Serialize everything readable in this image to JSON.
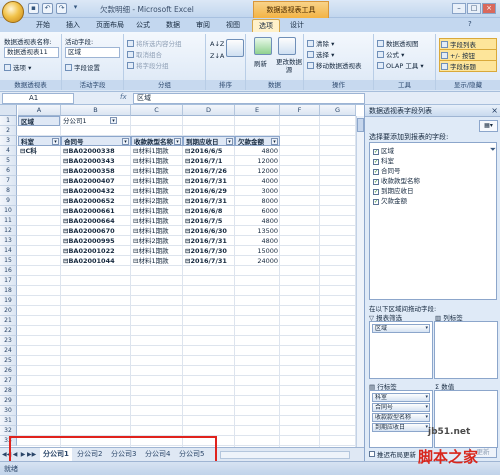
{
  "titlebar": {
    "window_title": "欠款明细 - Microsoft Excel",
    "contextual_group": "数据透视表工具"
  },
  "tabs": [
    "开始",
    "插入",
    "页面布局",
    "公式",
    "数据",
    "审阅",
    "视图",
    "选项",
    "设计"
  ],
  "active_tab": "选项",
  "ribbon": {
    "pivot_name_label": "数据透视表名称:",
    "pivot_name_value": "数据透视表11",
    "options_btn": "选项",
    "group1_label": "数据透视表",
    "active_field_label": "活动字段:",
    "active_field_value": "区域",
    "field_settings": "字段设置",
    "group2_label": "活动字段",
    "expand_btn": "将所选内容分组",
    "ungroup_btn": "取消组合",
    "groupfield_btn": "将字段分组",
    "group3_label": "分组",
    "sort_label": "排序",
    "group4_label": "排序",
    "refresh_label": "刷新",
    "change_source_label": "更改数据源",
    "group5_label": "数据",
    "clear_btn": "清除",
    "select_btn": "选择",
    "move_btn": "移动数据透视表",
    "group6_label": "操作",
    "pivotchart_btn": "数据透视图",
    "formula_btn": "公式",
    "olap_btn": "OLAP 工具",
    "group7_label": "工具",
    "field_list_btn": "字段列表",
    "plusminus_btn": "+/- 按钮",
    "field_headers_btn": "字段标题",
    "group8_label": "显示/隐藏"
  },
  "formula_bar": {
    "cell_ref": "A1",
    "fx": "fx",
    "content": "区域"
  },
  "columns": [
    "A",
    "B",
    "C",
    "D",
    "E",
    "F",
    "G"
  ],
  "rows": [
    "1",
    "2",
    "3",
    "4",
    "5",
    "6",
    "7",
    "8",
    "9",
    "10",
    "11",
    "12",
    "13",
    "14",
    "15",
    "16",
    "17",
    "18",
    "19",
    "20",
    "21",
    "22",
    "23",
    "24",
    "25",
    "26",
    "27",
    "28",
    "29",
    "30",
    "31",
    "32",
    "33"
  ],
  "pivot": {
    "filter_label": "区域",
    "filter_value": "分公司1",
    "headers": [
      "科室",
      "合同号",
      "收款款型名称",
      "到期应收日",
      "欠款金额"
    ],
    "rows": [
      {
        "dept": "C科",
        "contract": "BA02000338",
        "type": "材料1期款",
        "date": "2016/6/5",
        "amount": "4800"
      },
      {
        "dept": "",
        "contract": "BA02000343",
        "type": "材料1期款",
        "date": "2016/7/1",
        "amount": "12000"
      },
      {
        "dept": "",
        "contract": "BA02000358",
        "type": "材料1期款",
        "date": "2016/7/26",
        "amount": "12000"
      },
      {
        "dept": "",
        "contract": "BA02000407",
        "type": "材料1期款",
        "date": "2016/7/31",
        "amount": "4000"
      },
      {
        "dept": "",
        "contract": "BA02000432",
        "type": "材料1期款",
        "date": "2016/6/29",
        "amount": "3000"
      },
      {
        "dept": "",
        "contract": "BA02000652",
        "type": "材料2期款",
        "date": "2016/7/31",
        "amount": "8000"
      },
      {
        "dept": "",
        "contract": "BA02000661",
        "type": "材料1期款",
        "date": "2016/6/8",
        "amount": "6000"
      },
      {
        "dept": "",
        "contract": "BA02000664",
        "type": "材料1期款",
        "date": "2016/7/5",
        "amount": "4800"
      },
      {
        "dept": "",
        "contract": "BA02000670",
        "type": "材料1期款",
        "date": "2016/6/30",
        "amount": "13500"
      },
      {
        "dept": "",
        "contract": "BA02000995",
        "type": "材料2期款",
        "date": "2016/7/31",
        "amount": "4800"
      },
      {
        "dept": "",
        "contract": "BA02001022",
        "type": "材料1期款",
        "date": "2016/7/30",
        "amount": "15000"
      },
      {
        "dept": "",
        "contract": "BA02001044",
        "type": "材料1期款",
        "date": "2016/7/31",
        "amount": "24000"
      }
    ]
  },
  "sheet_tabs": [
    "分公司1",
    "分公司2",
    "分公司3",
    "分公司4",
    "分公司5"
  ],
  "active_sheet": "分公司1",
  "status": {
    "ready": "就绪"
  },
  "field_pane": {
    "title": "数据透视表字段列表",
    "prompt": "选择要添加到报表的字段:",
    "fields": [
      {
        "name": "区域",
        "checked": true
      },
      {
        "name": "科室",
        "checked": true
      },
      {
        "name": "合同号",
        "checked": true
      },
      {
        "name": "收款款型名称",
        "checked": true
      },
      {
        "name": "到期应收日",
        "checked": true
      },
      {
        "name": "欠款金额",
        "checked": true
      }
    ],
    "drag_prompt": "在以下区域间拖动字段:",
    "zone_filter_label": "报表筛选",
    "zone_column_label": "列标签",
    "zone_row_label": "行标签",
    "zone_values_label": "数值",
    "zone_values_sigma": "Σ",
    "filter_items": [
      "区域"
    ],
    "row_items": [
      "科室",
      "合同号",
      "收款款型名称",
      "到期应收日"
    ],
    "defer_label": "推迟布局更新",
    "update_btn": "更新"
  },
  "watermark": {
    "line1": "jb51.net",
    "line2": "脚本之家"
  },
  "colors": {
    "ribbon_bg": "#dbe7f5",
    "highlight": "#fde59a",
    "contextual_tab": "#f3b344",
    "annotation_red": "#e0221c"
  }
}
